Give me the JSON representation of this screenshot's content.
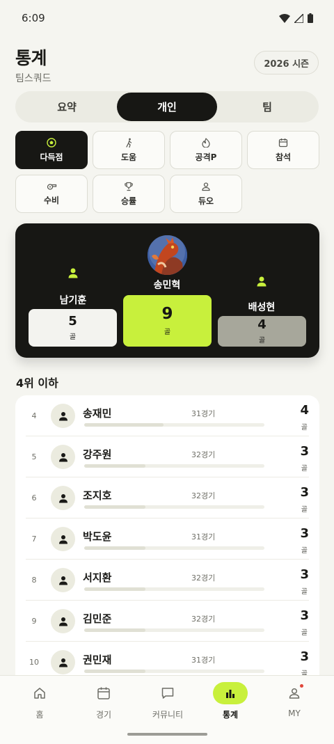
{
  "status_bar": {
    "time": "6:09"
  },
  "header": {
    "title": "통계",
    "subtitle": "팀스쿼드",
    "season": "2026 시즌"
  },
  "segments": [
    {
      "label": "요약",
      "active": false
    },
    {
      "label": "개인",
      "active": true
    },
    {
      "label": "팀",
      "active": false
    }
  ],
  "categories": [
    {
      "label": "다득점",
      "icon": "soccer-ball-icon",
      "active": true
    },
    {
      "label": "도움",
      "icon": "running-person-icon",
      "active": false
    },
    {
      "label": "공격P",
      "icon": "flame-icon",
      "active": false
    },
    {
      "label": "참석",
      "icon": "calendar-icon",
      "active": false
    },
    {
      "label": "수비",
      "icon": "whistle-icon",
      "active": false
    },
    {
      "label": "승률",
      "icon": "trophy-icon",
      "active": false
    },
    {
      "label": "듀오",
      "icon": "person-icon",
      "active": false
    }
  ],
  "podium": {
    "first": {
      "name": "송민혁",
      "value": "9",
      "unit": "골"
    },
    "second": {
      "name": "남기훈",
      "value": "5",
      "unit": "골"
    },
    "third": {
      "name": "배성현",
      "value": "4",
      "unit": "골"
    }
  },
  "ranking_title": "4위 이하",
  "ranking": [
    {
      "rank": "4",
      "name": "송재민",
      "games": "31경기",
      "value": "4",
      "unit": "골",
      "bar_fraction": 0.44
    },
    {
      "rank": "5",
      "name": "강주원",
      "games": "32경기",
      "value": "3",
      "unit": "골",
      "bar_fraction": 0.34
    },
    {
      "rank": "6",
      "name": "조지호",
      "games": "32경기",
      "value": "3",
      "unit": "골",
      "bar_fraction": 0.34
    },
    {
      "rank": "7",
      "name": "박도윤",
      "games": "31경기",
      "value": "3",
      "unit": "골",
      "bar_fraction": 0.34
    },
    {
      "rank": "8",
      "name": "서지환",
      "games": "32경기",
      "value": "3",
      "unit": "골",
      "bar_fraction": 0.34
    },
    {
      "rank": "9",
      "name": "김민준",
      "games": "32경기",
      "value": "3",
      "unit": "골",
      "bar_fraction": 0.34
    },
    {
      "rank": "10",
      "name": "권민재",
      "games": "31경기",
      "value": "3",
      "unit": "골",
      "bar_fraction": 0.34
    }
  ],
  "bottom_nav": [
    {
      "label": "홈",
      "icon": "home-icon",
      "active": false
    },
    {
      "label": "경기",
      "icon": "calendar-icon",
      "active": false
    },
    {
      "label": "커뮤니티",
      "icon": "chat-icon",
      "active": false
    },
    {
      "label": "통계",
      "icon": "bar-chart-icon",
      "active": true
    },
    {
      "label": "MY",
      "icon": "user-icon",
      "active": false,
      "badge": true
    }
  ],
  "colors": {
    "accent": "#c8f03c",
    "dark": "#171714",
    "second_block": "#f3f3ef",
    "third_block": "#a7a79b",
    "background": "#f5f5f0"
  }
}
